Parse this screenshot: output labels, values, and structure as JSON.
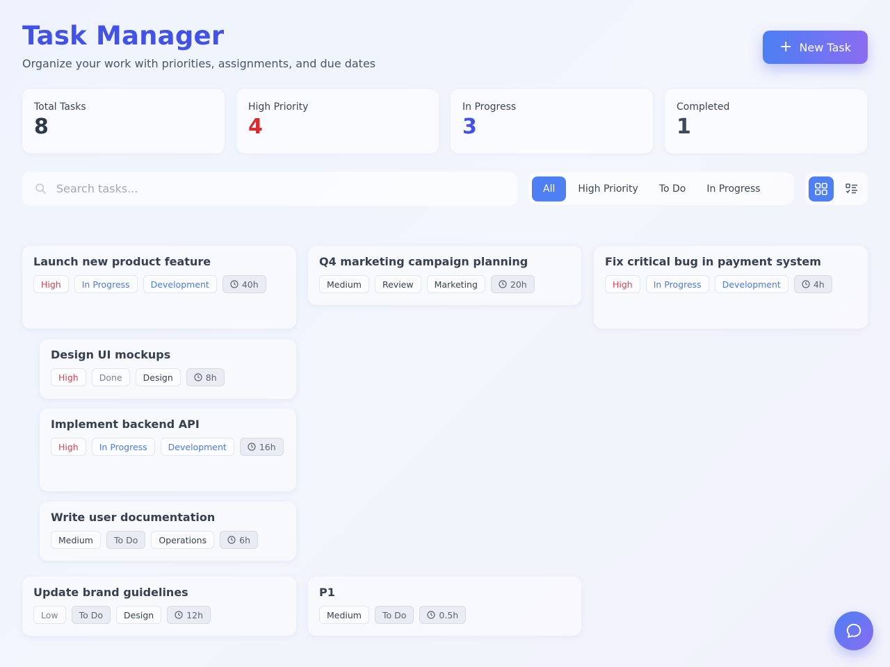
{
  "header": {
    "title": "Task Manager",
    "subtitle": "Organize your work with priorities, assignments, and due dates",
    "new_task_label": "New Task"
  },
  "stats": [
    {
      "label": "Total Tasks",
      "value": "8",
      "color": "#2d3748"
    },
    {
      "label": "High Priority",
      "value": "4",
      "color": "#d92b32"
    },
    {
      "label": "In Progress",
      "value": "3",
      "color": "#4352e6"
    },
    {
      "label": "Completed",
      "value": "1",
      "color": "#3e4a5c"
    }
  ],
  "search": {
    "placeholder": "Search tasks...",
    "value": ""
  },
  "filters": [
    {
      "label": "All",
      "active": true
    },
    {
      "label": "High Priority",
      "active": false
    },
    {
      "label": "To Do",
      "active": false
    },
    {
      "label": "In Progress",
      "active": false
    }
  ],
  "view_modes": [
    {
      "icon": "grid-icon",
      "active": true
    },
    {
      "icon": "list-icon",
      "active": false
    }
  ],
  "tasks": [
    {
      "title": "Launch new product feature",
      "priority": "High",
      "status": "In Progress",
      "category": "Development",
      "estimate": "40h"
    },
    {
      "title": "Q4 marketing campaign planning",
      "priority": "Medium",
      "status": "Review",
      "category": "Marketing",
      "estimate": "20h"
    },
    {
      "title": "Fix critical bug in payment system",
      "priority": "High",
      "status": "In Progress",
      "category": "Development",
      "estimate": "4h"
    },
    {
      "title": "Design UI mockups",
      "priority": "High",
      "status": "Done",
      "category": "Design",
      "estimate": "8h"
    },
    {
      "title": "Implement backend API",
      "priority": "High",
      "status": "In Progress",
      "category": "Development",
      "estimate": "16h"
    },
    {
      "title": "Write user documentation",
      "priority": "Medium",
      "status": "To Do",
      "category": "Operations",
      "estimate": "6h"
    },
    {
      "title": "Update brand guidelines",
      "priority": "Low",
      "status": "To Do",
      "category": "Design",
      "estimate": "12h"
    },
    {
      "title": "P1",
      "priority": "Medium",
      "status": "To Do",
      "category": "",
      "estimate": "0.5h"
    }
  ],
  "chat_icon": "chat-bubble-icon",
  "colors": {
    "accent": "#4f80f3",
    "accent_end": "#8a6cf1",
    "title": "#4352e6",
    "high": "#d9434d",
    "progress": "#4a7be0"
  }
}
